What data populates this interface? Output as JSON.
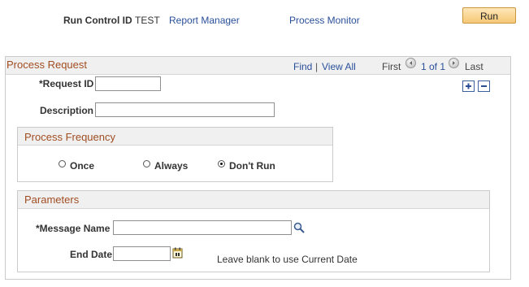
{
  "toolbar": {
    "run_control_label": "Run Control ID",
    "run_control_value": "TEST",
    "report_manager": "Report Manager",
    "process_monitor": "Process Monitor",
    "run_button": "Run"
  },
  "process_request": {
    "title": "Process Request",
    "find": "Find",
    "view_all": "View All",
    "first": "First",
    "range": "1 of 1",
    "last": "Last",
    "request_id_label": "*Request ID",
    "request_id_value": "",
    "description_label": "Description",
    "description_value": ""
  },
  "frequency": {
    "title": "Process Frequency",
    "options": [
      {
        "label": "Once",
        "selected": false
      },
      {
        "label": "Always",
        "selected": false
      },
      {
        "label": "Don't Run",
        "selected": true
      }
    ]
  },
  "parameters": {
    "title": "Parameters",
    "message_name_label": "*Message Name",
    "message_name_value": "",
    "end_date_label": "End Date",
    "end_date_value": "",
    "end_date_hint": "Leave blank to use Current Date"
  },
  "colors": {
    "section_title": "#a14d22",
    "link": "#2a4f9a",
    "run_button": "#f5c876"
  },
  "icons": {
    "lookup": "magnifier-icon",
    "calendar": "calendar-icon",
    "add_row": "plus-icon",
    "delete_row": "minus-icon",
    "previous": "previous-icon",
    "next": "next-icon"
  }
}
